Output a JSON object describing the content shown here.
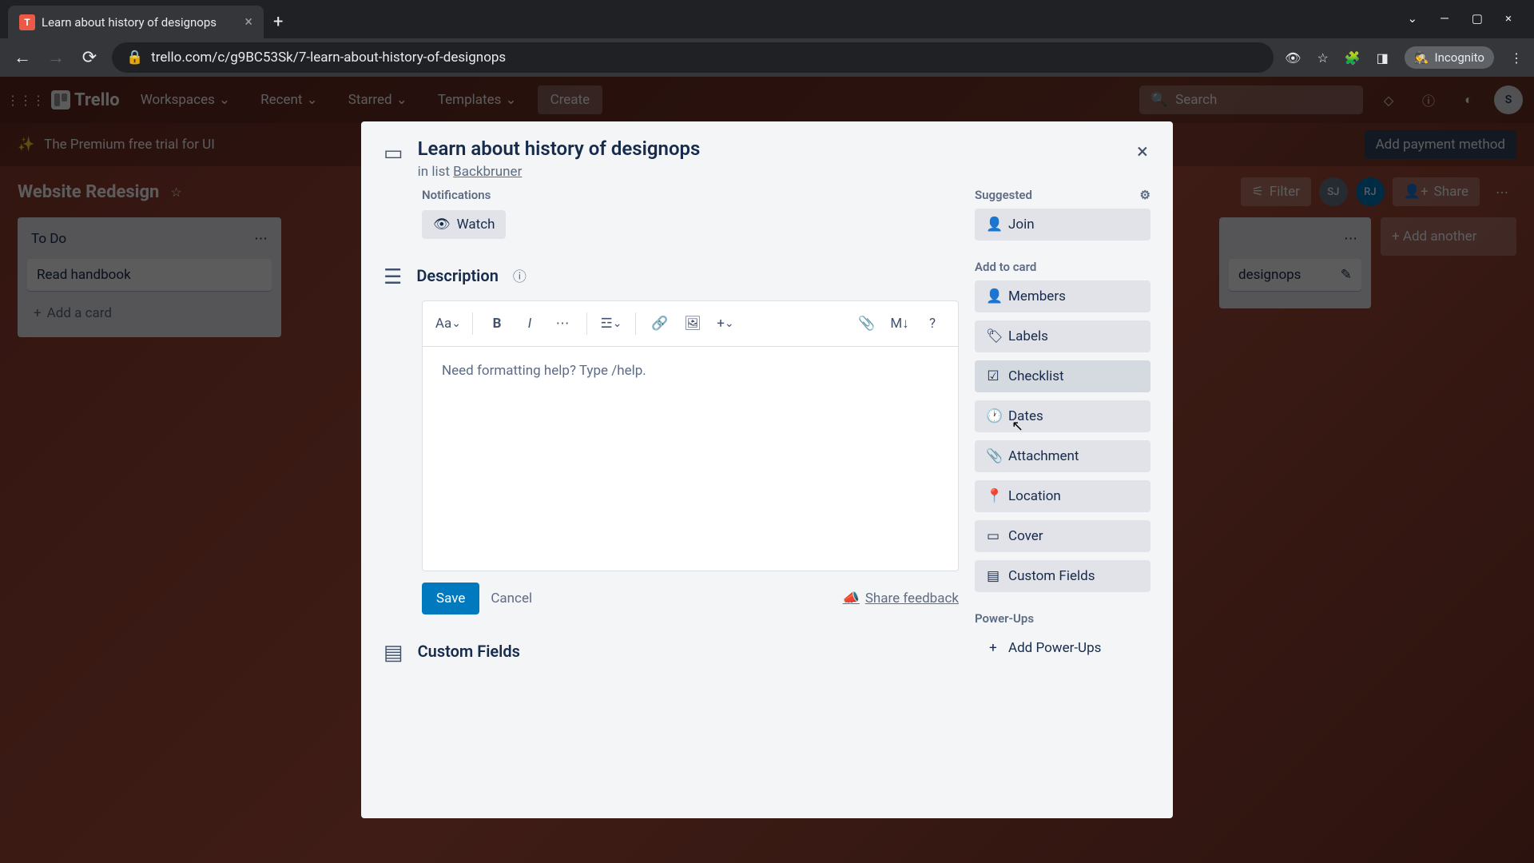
{
  "browser": {
    "tab_title": "Learn about history of designops",
    "url": "trello.com/c/g9BC53Sk/7-learn-about-history-of-designops",
    "incognito": "Incognito"
  },
  "trello_nav": {
    "logo": "Trello",
    "workspaces": "Workspaces",
    "recent": "Recent",
    "starred": "Starred",
    "templates": "Templates",
    "create": "Create",
    "search_placeholder": "Search"
  },
  "banner": {
    "text": "The Premium free trial for UI",
    "cta": "Add payment method"
  },
  "board": {
    "name": "Website Redesign",
    "filter": "Filter",
    "share": "Share",
    "members": [
      "SJ",
      "RJ"
    ]
  },
  "lists": {
    "todo": {
      "name": "To Do",
      "cards": [
        "Read handbook"
      ],
      "add": "Add a card"
    },
    "backburner_card": "designops",
    "add_another": "Add another"
  },
  "modal": {
    "title": "Learn about history of designops",
    "in_list_prefix": "in list ",
    "list_name": "Backbruner",
    "notifications": "Notifications",
    "watch": "Watch",
    "description": "Description",
    "editor_placeholder": "Need formatting help? Type /help.",
    "save": "Save",
    "cancel": "Cancel",
    "share_feedback": "Share feedback",
    "custom_fields": "Custom Fields"
  },
  "sidebar": {
    "suggested": "Suggested",
    "join": "Join",
    "add_to_card": "Add to card",
    "members": "Members",
    "labels": "Labels",
    "checklist": "Checklist",
    "dates": "Dates",
    "attachment": "Attachment",
    "location": "Location",
    "cover": "Cover",
    "custom_fields": "Custom Fields",
    "power_ups": "Power-Ups",
    "add_power_ups": "Add Power-Ups"
  }
}
